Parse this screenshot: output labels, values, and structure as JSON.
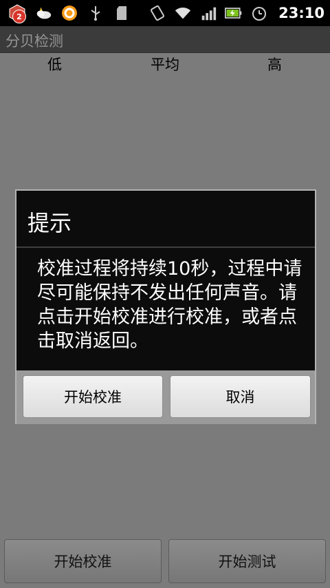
{
  "status_bar": {
    "notification_count": "2",
    "time": "23:10",
    "icons": [
      "app-badge-icon",
      "weather-icon",
      "browser-icon",
      "usb-icon",
      "sdcard-icon",
      "vibrate-icon",
      "wifi-icon",
      "signal-icon",
      "battery-charging-icon",
      "alarm-icon"
    ]
  },
  "app": {
    "title": "分贝检测"
  },
  "columns": {
    "low": "低",
    "avg": "平均",
    "high": "高"
  },
  "dialog": {
    "title": "提示",
    "message": "校准过程将持续10秒，过程中请尽可能保持不发出任何声音。请点击开始校准进行校准，或者点击取消返回。",
    "confirm_label": "开始校准",
    "cancel_label": "取消"
  },
  "bottom_bar": {
    "calibrate_label": "开始校准",
    "test_label": "开始测试"
  }
}
